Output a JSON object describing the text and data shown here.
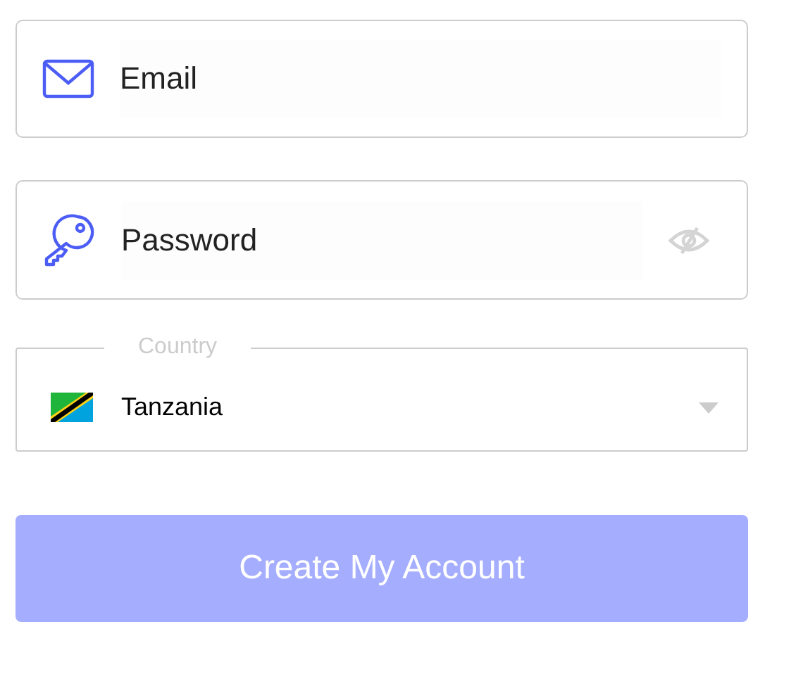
{
  "email": {
    "placeholder": "Email"
  },
  "password": {
    "placeholder": "Password"
  },
  "country": {
    "label": "Country",
    "value": "Tanzania"
  },
  "submit": {
    "label": "Create My Account",
    "disabled": true
  }
}
